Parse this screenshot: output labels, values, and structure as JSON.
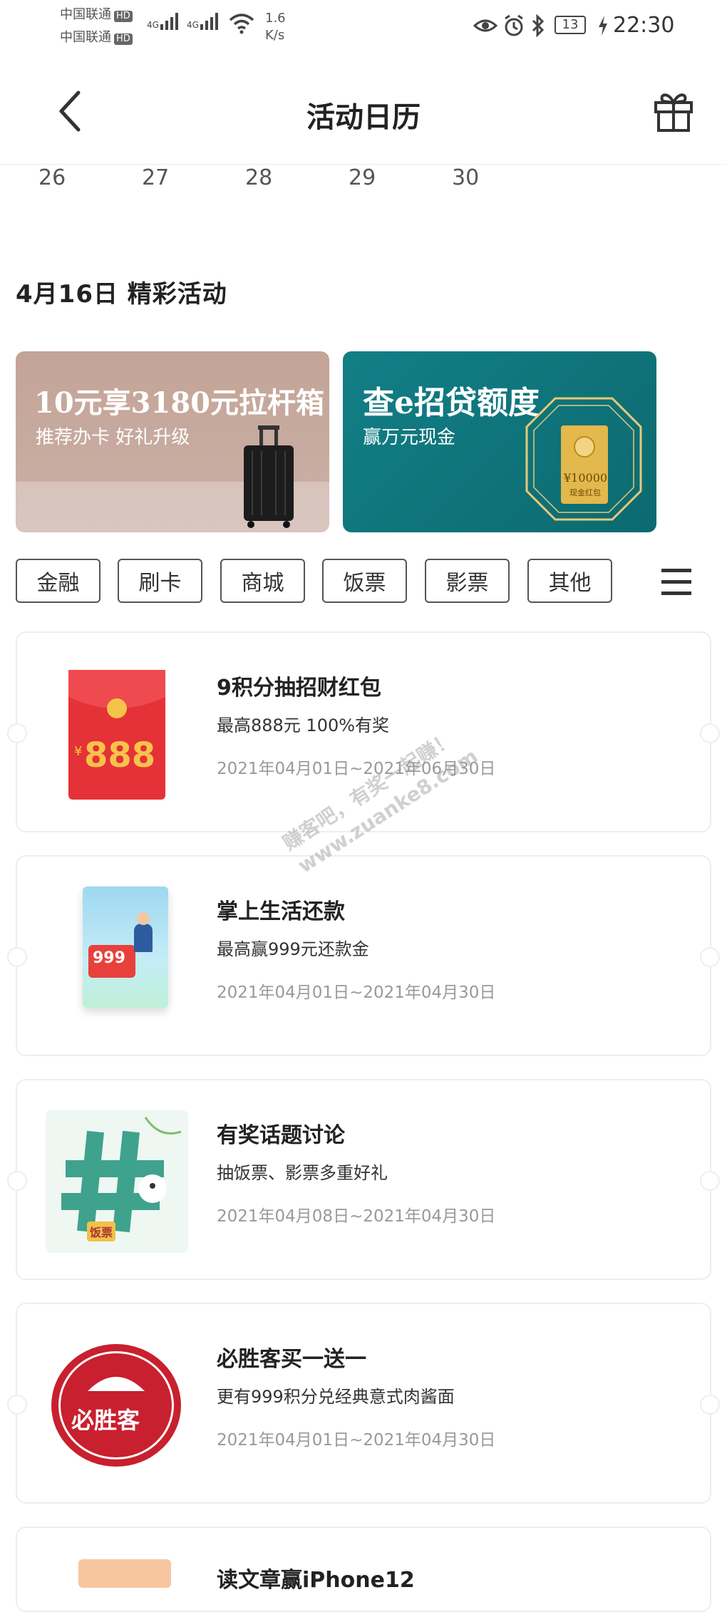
{
  "status_bar": {
    "carrier1": "中国联通",
    "carrier2": "中国联通",
    "hd": "HD",
    "network": "4G",
    "speed_value": "1.6",
    "speed_unit": "K/s",
    "battery": "13",
    "time": "22:30"
  },
  "header": {
    "title": "活动日历",
    "back_icon": "chevron-left",
    "gift_icon": "gift"
  },
  "calendar": {
    "days": [
      "26",
      "27",
      "28",
      "29",
      "30"
    ]
  },
  "section": {
    "heading": "4月16日  精彩活动"
  },
  "banners": [
    {
      "title": "10元享3180元拉杆箱",
      "subtitle": "推荐办卡 好礼升级"
    },
    {
      "title": "查e招贷额度",
      "subtitle": "赢万元现金",
      "badge_amount": "¥10000",
      "badge_label": "现金红包"
    }
  ],
  "filters": [
    "金融",
    "刷卡",
    "商城",
    "饭票",
    "影票",
    "其他"
  ],
  "menu_icon": "menu",
  "activities": [
    {
      "title": "9积分抽招财红包",
      "subtitle": "最高888元 100%有奖",
      "date": "2021年04月01日~2021年06月30日",
      "thumb_text": "888",
      "thumb_currency": "¥"
    },
    {
      "title": "掌上生活还款",
      "subtitle": "最高赢999元还款金",
      "date": "2021年04月01日~2021年04月30日",
      "thumb_text": "999"
    },
    {
      "title": "有奖话题讨论",
      "subtitle": "抽饭票、影票多重好礼",
      "date": "2021年04月08日~2021年04月30日",
      "thumb_text": "饭票"
    },
    {
      "title": "必胜客买一送一",
      "subtitle": "更有999积分兑经典意式肉酱面",
      "date": "2021年04月01日~2021年04月30日",
      "thumb_text": "必胜客"
    },
    {
      "title": "读文章赢iPhone12"
    }
  ],
  "watermark": {
    "line1": "赚客吧，有奖一起赚！",
    "line2": "www.zuanke8.com"
  },
  "colors": {
    "banner1_bg": "#c9a99c",
    "banner2_bg": "#0f7f86",
    "red_envelope": "#e8323a",
    "pizza_red": "#c8202e"
  }
}
